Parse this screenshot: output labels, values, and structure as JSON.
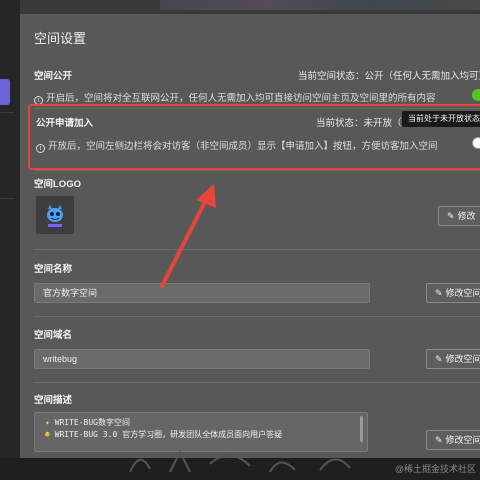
{
  "panel": {
    "title": "空间设置"
  },
  "public": {
    "label": "空间公开",
    "status": "当前空间状态：公开（任何人无需加入均可直接",
    "hint": "开启后，空间将对全互联网公开，任何人无需加入均可直接访问空间主页及空间里的所有内容",
    "enabled": true,
    "toggle_color": "#52c41a"
  },
  "apply": {
    "label": "公开申请加入",
    "status": "当前状态：未开放（",
    "hint": "开放后，空间左侧边栏将会对访客（非空间成员）显示【申请加入】按钮，方便访客加入空间",
    "tooltip": "当前处于未开放状态",
    "enabled": false,
    "highlight_color": "#e8443a"
  },
  "logo": {
    "label": "空间LOGO",
    "icon": "app-logo-icon",
    "edit_label": "修改"
  },
  "name": {
    "label": "空间名称",
    "value": "官方数字空间",
    "edit_label": "修改空间"
  },
  "domain_field": {
    "label": "空间域名",
    "value": "writebug",
    "edit_label": "修改空间"
  },
  "desc": {
    "label": "空间描述",
    "lines": [
      "WRITE-BUG数字空间",
      "WRITE-BUG 3.0 官方学习圈，研发团队全体成员面向用户答疑"
    ],
    "edit_label": "修改空间"
  },
  "watermark": "@稀土掘金技术社区",
  "icons": {
    "info": "info-icon",
    "edit": "edit-icon",
    "arrow": "red-annotation-arrow"
  },
  "colors": {
    "panel": "#585858",
    "accent": "#6c63d9"
  }
}
